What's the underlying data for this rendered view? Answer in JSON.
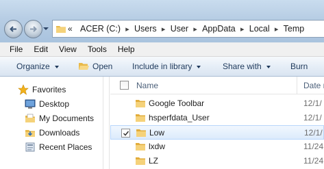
{
  "address": {
    "overflow": "«",
    "crumbs": [
      "ACER (C:)",
      "Users",
      "User",
      "AppData",
      "Local",
      "Temp"
    ],
    "separator": "▸"
  },
  "menu": [
    "File",
    "Edit",
    "View",
    "Tools",
    "Help"
  ],
  "toolbar": {
    "organize": "Organize",
    "open": "Open",
    "include": "Include in library",
    "share": "Share with",
    "burn": "Burn"
  },
  "nav": {
    "favorites": "Favorites",
    "items": [
      "Desktop",
      "My Documents",
      "Downloads",
      "Recent Places"
    ]
  },
  "list": {
    "col_name": "Name",
    "col_date": "Date m",
    "rows": [
      {
        "name": "Google Toolbar",
        "date": "12/1/",
        "selected": false
      },
      {
        "name": "hsperfdata_User",
        "date": "12/1/",
        "selected": false
      },
      {
        "name": "Low",
        "date": "12/1/",
        "selected": true
      },
      {
        "name": "lxdw",
        "date": "11/24",
        "selected": false
      },
      {
        "name": "LZ",
        "date": "11/24",
        "selected": false
      }
    ]
  },
  "colors": {
    "title_bar": "#b7cde4",
    "toolbar_text": "#1e395b",
    "selection": "#dcebfc",
    "folder": "#f2c55c"
  }
}
